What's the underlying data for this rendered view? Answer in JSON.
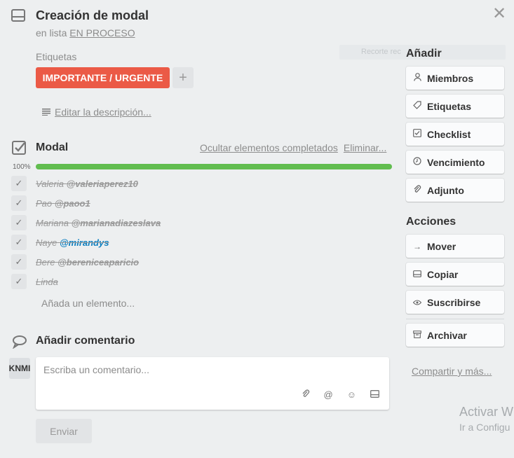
{
  "card": {
    "title": "Creación de modal",
    "list_prefix": "en lista",
    "list_name": "EN PROCESO"
  },
  "labels": {
    "heading": "Etiquetas",
    "items": [
      {
        "text": "IMPORTANTE / URGENTE",
        "color": "#eb5a46"
      }
    ],
    "add": "+"
  },
  "description": {
    "link": "Editar la descripción..."
  },
  "checklist": {
    "title": "Modal",
    "hide_completed": "Ocultar elementos completados",
    "delete": "Eliminar...",
    "percent_label": "100%",
    "progress": 1.0,
    "items": [
      {
        "name": "Valeria",
        "mention": "@valeriaperez10",
        "checked": true,
        "highlight": false
      },
      {
        "name": "Pao",
        "mention": "@paoo1",
        "checked": true,
        "highlight": false
      },
      {
        "name": "Mariana",
        "mention": "@marianadiazeslava",
        "checked": true,
        "highlight": false
      },
      {
        "name": "Naye",
        "mention": "@mirandys",
        "checked": true,
        "highlight": true
      },
      {
        "name": "Bere",
        "mention": "@bereniceaparicio",
        "checked": true,
        "highlight": false
      },
      {
        "name": "Linda",
        "mention": "",
        "checked": true,
        "highlight": false
      }
    ],
    "add_item": "Añada un elemento..."
  },
  "comment": {
    "title": "Añadir comentario",
    "avatar": "KNMI",
    "placeholder": "Escriba un comentario...",
    "send": "Enviar"
  },
  "sidebar": {
    "add_title": "Añadir",
    "add_buttons": [
      {
        "label": "Miembros",
        "icon": "person-icon"
      },
      {
        "label": "Etiquetas",
        "icon": "tag-icon"
      },
      {
        "label": "Checklist",
        "icon": "checkbox-icon"
      },
      {
        "label": "Vencimiento",
        "icon": "clock-icon"
      },
      {
        "label": "Adjunto",
        "icon": "paperclip-icon"
      }
    ],
    "actions_title": "Acciones",
    "action_buttons": [
      {
        "label": "Mover",
        "icon": "arrow-right-icon"
      },
      {
        "label": "Copiar",
        "icon": "card-icon"
      },
      {
        "label": "Suscribirse",
        "icon": "eye-icon"
      },
      {
        "label": "Archivar",
        "icon": "archive-icon"
      }
    ],
    "share": "Compartir y más..."
  },
  "background_ghost": "Recorte rec",
  "watermark": {
    "line1": "Activar W",
    "line2": "Ir a Configu"
  }
}
